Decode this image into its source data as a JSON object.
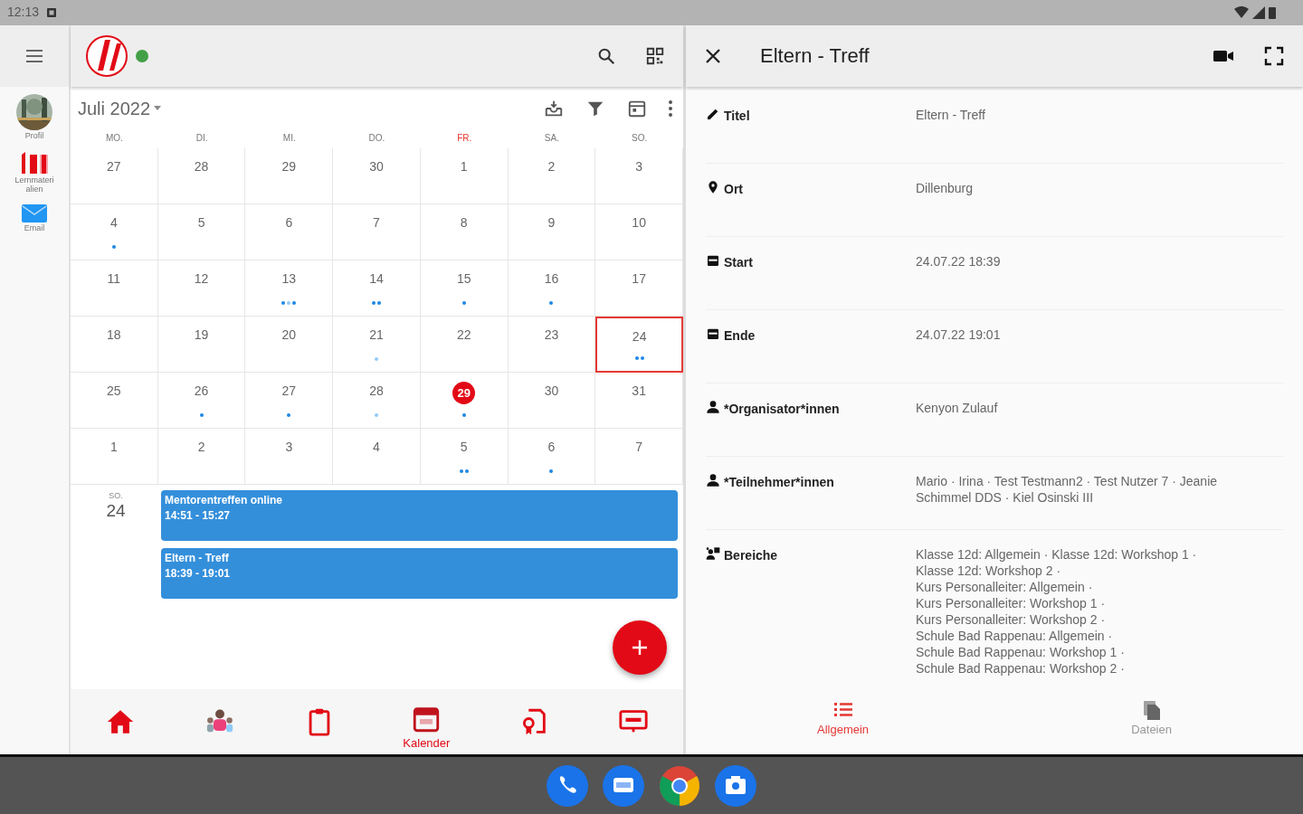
{
  "status_bar": {
    "time": "12:13"
  },
  "rail": {
    "items": [
      {
        "kind": "avatar",
        "label": "Profil"
      },
      {
        "kind": "materials",
        "label": "Lernmaterialien"
      },
      {
        "kind": "mail",
        "label": "Email"
      }
    ]
  },
  "app_bar": {
    "online": true
  },
  "calendar": {
    "month": "Juli 2022",
    "weekdays": [
      {
        "label": "MO.",
        "highlighted": false
      },
      {
        "label": "DI.",
        "highlighted": false
      },
      {
        "label": "MI.",
        "highlighted": false
      },
      {
        "label": "DO.",
        "highlighted": false
      },
      {
        "label": "FR.",
        "highlighted": true
      },
      {
        "label": "SA.",
        "highlighted": false
      },
      {
        "label": "SO.",
        "highlighted": false
      }
    ],
    "days": [
      {
        "label": "27",
        "selected": false,
        "today": false
      },
      {
        "label": "28",
        "selected": false,
        "today": false
      },
      {
        "label": "29",
        "selected": false,
        "today": false
      },
      {
        "label": "30",
        "selected": false,
        "today": false
      },
      {
        "label": "1",
        "selected": false,
        "today": false
      },
      {
        "label": "2",
        "selected": false,
        "today": false
      },
      {
        "label": "3",
        "selected": false,
        "today": false
      },
      {
        "label": "4",
        "selected": false,
        "today": false,
        "dots": [
          {
            "color": "#1e88e5"
          }
        ]
      },
      {
        "label": "5",
        "selected": false,
        "today": false
      },
      {
        "label": "6",
        "selected": false,
        "today": false
      },
      {
        "label": "7",
        "selected": false,
        "today": false
      },
      {
        "label": "8",
        "selected": false,
        "today": false
      },
      {
        "label": "9",
        "selected": false,
        "today": false
      },
      {
        "label": "10",
        "selected": false,
        "today": false
      },
      {
        "label": "11",
        "selected": false,
        "today": false
      },
      {
        "label": "12",
        "selected": false,
        "today": false
      },
      {
        "label": "13",
        "selected": false,
        "today": false,
        "dots": [
          {
            "color": "#1e88e5"
          },
          {
            "color": "#90caf9"
          },
          {
            "color": "#1e88e5"
          }
        ]
      },
      {
        "label": "14",
        "selected": false,
        "today": false,
        "dots": [
          {
            "color": "#1e88e5"
          },
          {
            "color": "#1e88e5"
          }
        ]
      },
      {
        "label": "15",
        "selected": false,
        "today": false,
        "dots": [
          {
            "color": "#1e88e5"
          }
        ]
      },
      {
        "label": "16",
        "selected": false,
        "today": false,
        "dots": [
          {
            "color": "#1e88e5"
          }
        ]
      },
      {
        "label": "17",
        "selected": false,
        "today": false
      },
      {
        "label": "18",
        "selected": false,
        "today": false
      },
      {
        "label": "19",
        "selected": false,
        "today": false
      },
      {
        "label": "20",
        "selected": false,
        "today": false
      },
      {
        "label": "21",
        "selected": false,
        "today": false,
        "dots": [
          {
            "color": "#90caf9"
          }
        ]
      },
      {
        "label": "22",
        "selected": false,
        "today": false
      },
      {
        "label": "23",
        "selected": false,
        "today": false
      },
      {
        "label": "24",
        "selected": true,
        "today": false,
        "dots": [
          {
            "color": "#1e88e5"
          },
          {
            "color": "#1e88e5"
          }
        ]
      },
      {
        "label": "25",
        "selected": false,
        "today": false
      },
      {
        "label": "26",
        "selected": false,
        "today": false,
        "dots": [
          {
            "color": "#1e88e5"
          }
        ]
      },
      {
        "label": "27",
        "selected": false,
        "today": false,
        "dots": [
          {
            "color": "#1e88e5"
          }
        ]
      },
      {
        "label": "28",
        "selected": false,
        "today": false,
        "dots": [
          {
            "color": "#90caf9"
          }
        ]
      },
      {
        "label": "29",
        "selected": false,
        "today": true,
        "dots": [
          {
            "color": "#1e88e5"
          }
        ]
      },
      {
        "label": "30",
        "selected": false,
        "today": false
      },
      {
        "label": "31",
        "selected": false,
        "today": false
      },
      {
        "label": "1",
        "selected": false,
        "today": false
      },
      {
        "label": "2",
        "selected": false,
        "today": false
      },
      {
        "label": "3",
        "selected": false,
        "today": false
      },
      {
        "label": "4",
        "selected": false,
        "today": false
      },
      {
        "label": "5",
        "selected": false,
        "today": false,
        "dots": [
          {
            "color": "#1e88e5"
          },
          {
            "color": "#1e88e5"
          }
        ]
      },
      {
        "label": "6",
        "selected": false,
        "today": false,
        "dots": [
          {
            "color": "#1e88e5"
          }
        ]
      },
      {
        "label": "7",
        "selected": false,
        "today": false
      }
    ]
  },
  "agenda": {
    "weekday": "SO.",
    "day": "24",
    "events": [
      {
        "title": "Mentorentreffen online",
        "time": "14:51 - 15:27"
      },
      {
        "title": "Eltern - Treff",
        "time": "18:39 - 19:01"
      }
    ]
  },
  "bottom_nav": [
    {
      "selected": false
    },
    {
      "selected": false
    },
    {
      "selected": false
    },
    {
      "label": "Kalender",
      "selected": true
    },
    {
      "selected": false
    },
    {
      "selected": false
    }
  ],
  "detail": {
    "title": "Eltern - Treff",
    "fields": [
      {
        "label": "Titel",
        "value": "Eltern - Treff"
      },
      {
        "label": "Ort",
        "value": "Dillenburg"
      },
      {
        "label": "Start",
        "value": "24.07.22 18:39"
      },
      {
        "label": "Ende",
        "value": "24.07.22 19:01"
      },
      {
        "label": "*Organisator*innen",
        "value": "Kenyon Zulauf"
      },
      {
        "label": "*Teilnehmer*innen",
        "value": "Mario · Irina · Test Testmann2 · Test Nutzer 7 · Jeanie Schimmel DDS · Kiel Osinski III"
      },
      {
        "label": "Bereiche",
        "lines": [
          "Klasse 12d: Allgemein · Klasse 12d: Workshop 1 ·",
          "Klasse 12d: Workshop 2 ·",
          "Kurs Personalleiter: Allgemein ·",
          "Kurs Personalleiter: Workshop 1 ·",
          "Kurs Personalleiter: Workshop 2 ·",
          "Schule Bad Rappenau: Allgemein ·",
          "Schule Bad Rappenau: Workshop 1 ·",
          "Schule Bad Rappenau: Workshop 2 ·"
        ]
      }
    ],
    "tabs": [
      {
        "label": "Allgemein",
        "selected": true
      },
      {
        "label": "Dateien",
        "selected": false
      }
    ]
  },
  "dock": [
    {
      "kind": "phone"
    },
    {
      "kind": "message"
    },
    {
      "kind": "ring"
    },
    {
      "kind": "camera"
    }
  ]
}
